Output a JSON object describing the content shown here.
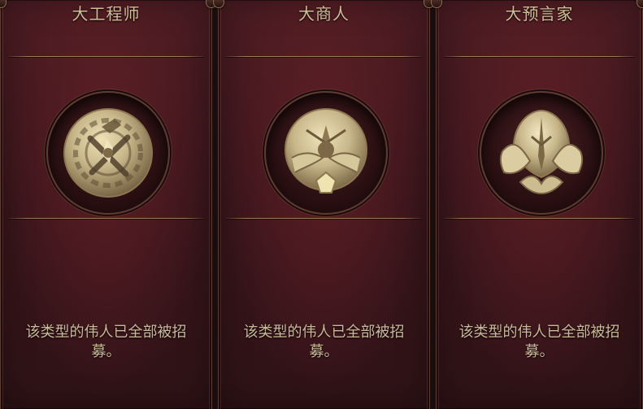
{
  "panels": [
    {
      "title": "大工程师",
      "emblem_icon": "engineer-gear-emblem-icon",
      "message": "该类型的伟人已全部被招募。"
    },
    {
      "title": "大商人",
      "emblem_icon": "merchant-gem-emblem-icon",
      "message": "该类型的伟人已全部被招募。"
    },
    {
      "title": "大预言家",
      "emblem_icon": "prophet-winged-emblem-icon",
      "message": "该类型的伟人已全部被招募。"
    }
  ],
  "colors": {
    "panel_background": "#3a161b",
    "panel_border": "#5f4034",
    "title_text": "#cfbe98",
    "body_text": "#cbb99a",
    "medallion_gold": "#c8b78a"
  }
}
